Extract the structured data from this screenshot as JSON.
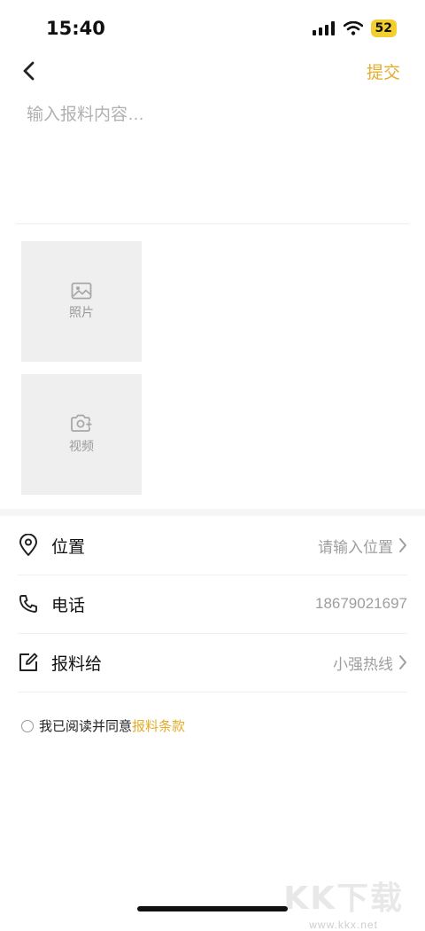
{
  "status": {
    "time": "15:40",
    "battery": "52"
  },
  "nav": {
    "submit_label": "提交"
  },
  "content": {
    "placeholder": "输入报料内容…"
  },
  "media": {
    "photo_label": "照片",
    "video_label": "视频"
  },
  "rows": {
    "location": {
      "label": "位置",
      "value": "请输入位置"
    },
    "phone": {
      "label": "电话",
      "value": "18679021697"
    },
    "report_to": {
      "label": "报料给",
      "value": "小强热线"
    }
  },
  "agreement": {
    "text": "我已阅读并同意",
    "link": "报料条款"
  },
  "watermark": {
    "big": "KK下载",
    "small": "www.kkx.net"
  },
  "colors": {
    "accent": "#e4ac2a",
    "battery": "#f2cf2f"
  }
}
